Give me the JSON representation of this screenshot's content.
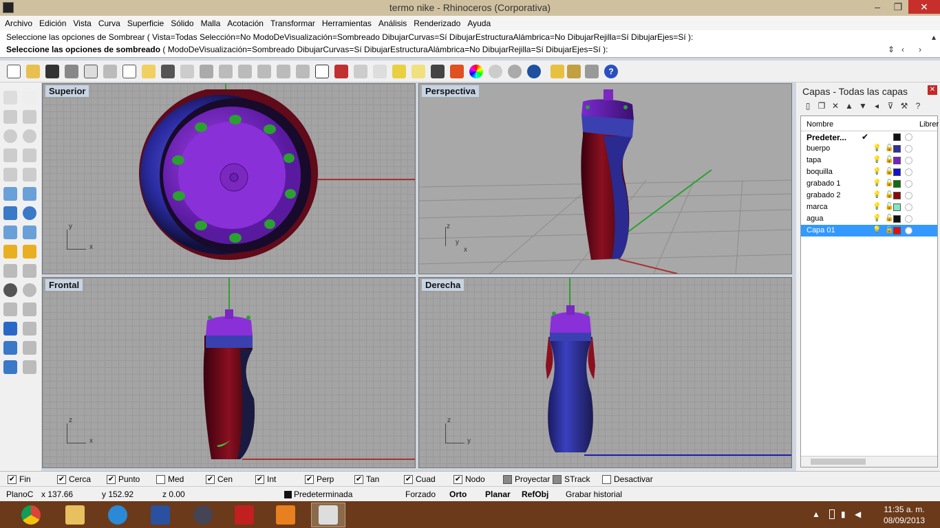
{
  "window": {
    "title": "termo nike - Rhinoceros (Corporativa)",
    "min": "–",
    "max": "❐",
    "close": "✕"
  },
  "menu": [
    "Archivo",
    "Edición",
    "Vista",
    "Curva",
    "Superficie",
    "Sólido",
    "Malla",
    "Acotación",
    "Transformar",
    "Herramientas",
    "Análisis",
    "Renderizado",
    "Ayuda"
  ],
  "command": {
    "history": "Seleccione las opciones de Sombrear ( Vista=Todas  Selección=No  ModoDeVisualización=Sombreado  DibujarCurvas=Sí  DibujarEstructuraAlámbrica=No  DibujarRejilla=Sí  DibujarEjes=Sí ):",
    "prompt_bold": "Seleccione las opciones de sombreado",
    "prompt_rest": " ( ModoDeVisualización=Sombreado  DibujarCurvas=Sí  DibujarEstructuraAlámbrica=No  DibujarRejilla=Sí  DibujarEjes=Sí ):"
  },
  "viewports": {
    "top": "Superior",
    "perspective": "Perspectiva",
    "front": "Frontal",
    "right": "Derecha"
  },
  "axes": {
    "x": "x",
    "y": "y",
    "z": "z"
  },
  "layers": {
    "title": "Capas - Todas las capas",
    "col_name": "Nombre",
    "col_material": "Librer",
    "rows": [
      {
        "name": "Predeter...",
        "color": "#111111",
        "current": "✔"
      },
      {
        "name": "buerpo",
        "color": "#3030a0"
      },
      {
        "name": "tapa",
        "color": "#7a22c0"
      },
      {
        "name": "boquilla",
        "color": "#1010d0"
      },
      {
        "name": "grabado 1",
        "color": "#107010"
      },
      {
        "name": "grabado 2",
        "color": "#8a0a0a"
      },
      {
        "name": "marca",
        "color": "#80e8c0"
      },
      {
        "name": "agua",
        "color": "#111111"
      },
      {
        "name": "Capa 01",
        "color": "#e01010"
      }
    ]
  },
  "osnap": [
    {
      "label": "Fin",
      "checked": "✔"
    },
    {
      "label": "Cerca",
      "checked": "✔"
    },
    {
      "label": "Punto",
      "checked": "✔"
    },
    {
      "label": "Med",
      "checked": ""
    },
    {
      "label": "Cen",
      "checked": "✔"
    },
    {
      "label": "Int",
      "checked": "✔"
    },
    {
      "label": "Perp",
      "checked": "✔"
    },
    {
      "label": "Tan",
      "checked": "✔"
    },
    {
      "label": "Cuad",
      "checked": "✔"
    },
    {
      "label": "Nodo",
      "checked": "✔"
    },
    {
      "label": "Proyectar",
      "checked": ""
    },
    {
      "label": "STrack",
      "checked": ""
    },
    {
      "label": "Desactivar",
      "checked": ""
    }
  ],
  "status": {
    "plane": "PlanoC",
    "x": "x 137.66",
    "y": "y 152.92",
    "z": "z 0.00",
    "layer": "Predeterminada",
    "forzado": "Forzado",
    "orto": "Orto",
    "planar": "Planar",
    "refobj": "RefObj",
    "history": "Grabar historial"
  },
  "clock": {
    "time": "11:35 a. m.",
    "date": "08/09/2013"
  }
}
